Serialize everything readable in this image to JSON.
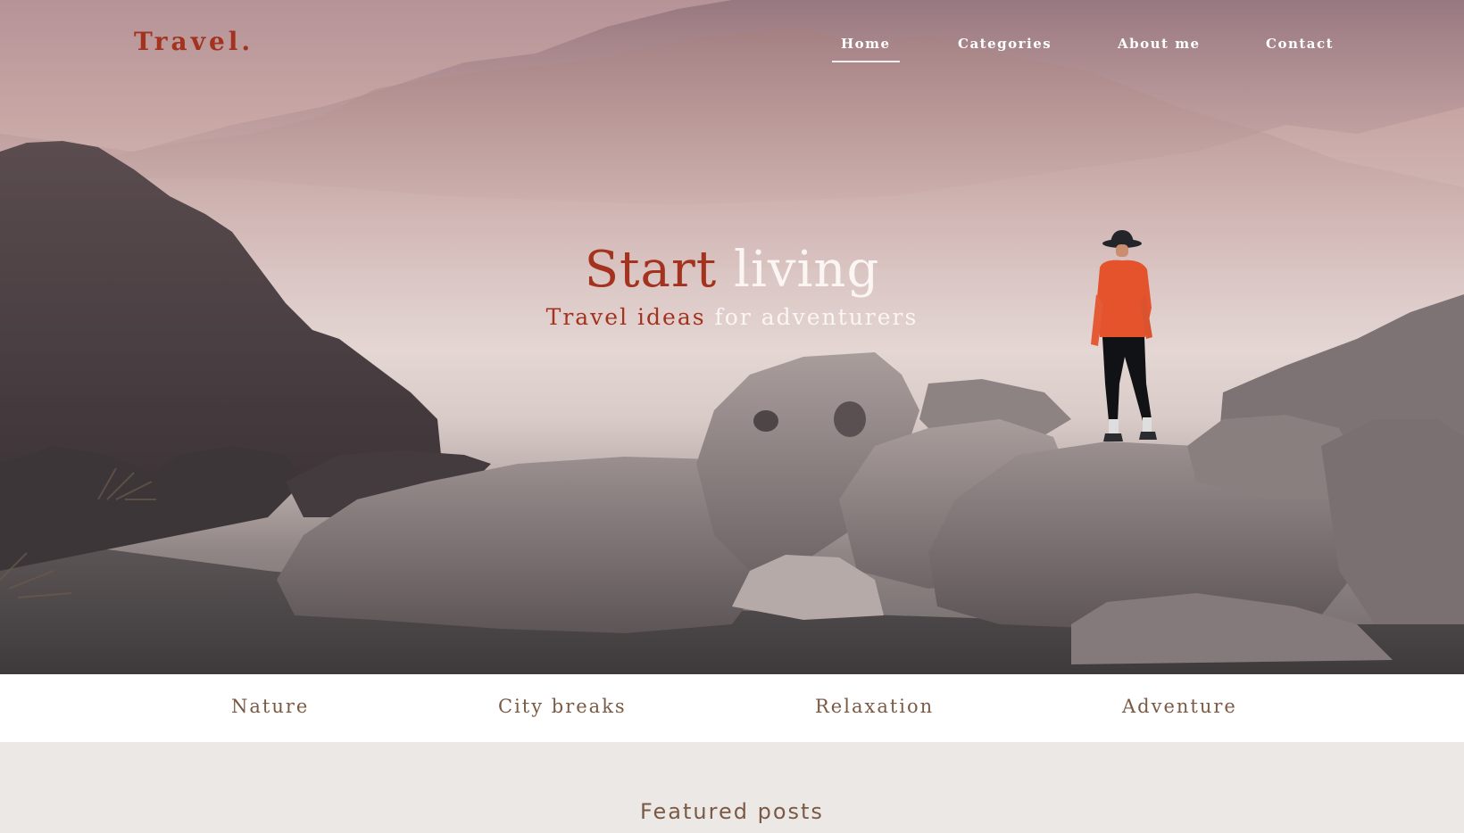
{
  "nav": {
    "logo": "Travel.",
    "links": [
      {
        "label": "Home",
        "active": true
      },
      {
        "label": "Categories",
        "active": false
      },
      {
        "label": "About me",
        "active": false
      },
      {
        "label": "Contact",
        "active": false
      }
    ]
  },
  "hero": {
    "title_accent": "Start",
    "title_rest": "living",
    "subtitle_accent": "Travel ideas",
    "subtitle_rest": "for adventurers"
  },
  "categories": [
    "Nature",
    "City breaks",
    "Relaxation",
    "Adventure"
  ],
  "featured": {
    "title": "Featured posts"
  },
  "colors": {
    "accent": "#a3321f",
    "category_text": "#7b5a45",
    "section_bg": "#ece8e5"
  }
}
